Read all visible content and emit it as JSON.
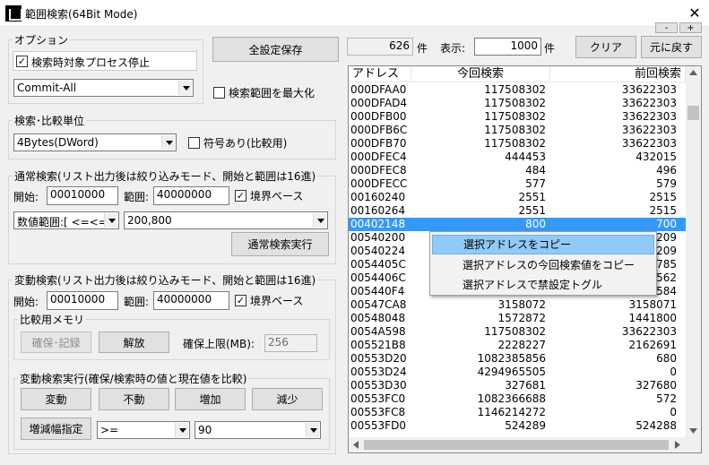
{
  "window": {
    "title": "範囲検索(64Bit Mode)",
    "close": "✕"
  },
  "options": {
    "legend": "オプション",
    "stop_process_label": "検索時対象プロセス停止",
    "stop_process_checked": true,
    "memory_type": "Commit-All"
  },
  "save_all_label": "全設定保存",
  "maximize_range_label": "検索範囲を最大化",
  "unit": {
    "legend": "検索･比較単位",
    "type": "4Bytes(DWord)",
    "signed_label": "符号あり(比較用)"
  },
  "normal_search": {
    "legend": "通常検索(リスト出力後は絞り込みモード、開始と範囲は16進)",
    "start_label": "開始:",
    "start": "00010000",
    "range_label": "範囲:",
    "range": "40000000",
    "boundary_label": "境界ベース",
    "mode": "数値範囲:[ <=<= ]",
    "value": "200,800",
    "run_label": "通常検索実行"
  },
  "change_search": {
    "legend": "変動検索(リスト出力後は絞り込みモード、開始と範囲は16進)",
    "start_label": "開始:",
    "start": "00010000",
    "range_label": "範囲:",
    "range": "40000000",
    "boundary_label": "境界ベース"
  },
  "compare_memory": {
    "legend": "比較用メモリ",
    "reserve_label": "確保･記録",
    "release_label": "解放",
    "limit_label": "確保上限(MB):",
    "limit": "256"
  },
  "change_run": {
    "legend": "変動検索実行(確保/検索時の値と現在値を比較)",
    "changed": "変動",
    "unchanged": "不動",
    "increased": "増加",
    "decreased": "減少",
    "delta_label": "増減幅指定",
    "op": ">=",
    "delta": "90"
  },
  "top_bar": {
    "count": "626",
    "count_unit": "件",
    "display_label": "表示:",
    "display": "1000",
    "display_unit": "件",
    "clear_label": "クリア",
    "restore_label": "元に戻す",
    "minus_label": "-",
    "plus_label": "+"
  },
  "results": {
    "headers": [
      "アドレス",
      "今回検索",
      "前回検索"
    ],
    "rows": [
      [
        "000DFAA0",
        "117508302",
        "33622303"
      ],
      [
        "000DFAD4",
        "117508302",
        "33622303"
      ],
      [
        "000DFB00",
        "117508302",
        "33622303"
      ],
      [
        "000DFB6C",
        "117508302",
        "33622303"
      ],
      [
        "000DFB70",
        "117508302",
        "33622303"
      ],
      [
        "000DFEC4",
        "444453",
        "432015"
      ],
      [
        "000DFEC8",
        "484",
        "496"
      ],
      [
        "000DFECC",
        "577",
        "579"
      ],
      [
        "00160240",
        "2551",
        "2515"
      ],
      [
        "00160264",
        "2551",
        "2515"
      ],
      [
        "00402148",
        "800",
        "700"
      ],
      [
        "00540200",
        "",
        "3209"
      ],
      [
        "00540224",
        "",
        "3209"
      ],
      [
        "0054405C",
        "",
        "5785"
      ],
      [
        "0054406C",
        "",
        "5562"
      ],
      [
        "005440F4",
        "",
        "1584"
      ],
      [
        "00547CA8",
        "3158072",
        "3158071"
      ],
      [
        "00548048",
        "1572872",
        "1441800"
      ],
      [
        "0054A598",
        "117508302",
        "33622303"
      ],
      [
        "005521B8",
        "2228227",
        "2162691"
      ],
      [
        "00553D20",
        "1082385856",
        "680"
      ],
      [
        "00553D24",
        "4294965505",
        "0"
      ],
      [
        "00553D30",
        "327681",
        "327680"
      ],
      [
        "00553FC0",
        "1082366688",
        "572"
      ],
      [
        "00553FC8",
        "1146214272",
        "0"
      ],
      [
        "00553FD0",
        "524289",
        "524288"
      ]
    ]
  },
  "context_menu": {
    "items": [
      "選択アドレスをコピー",
      "選択アドレスの今回検索値をコピー",
      "選択アドレスで禁設定トグル"
    ]
  }
}
